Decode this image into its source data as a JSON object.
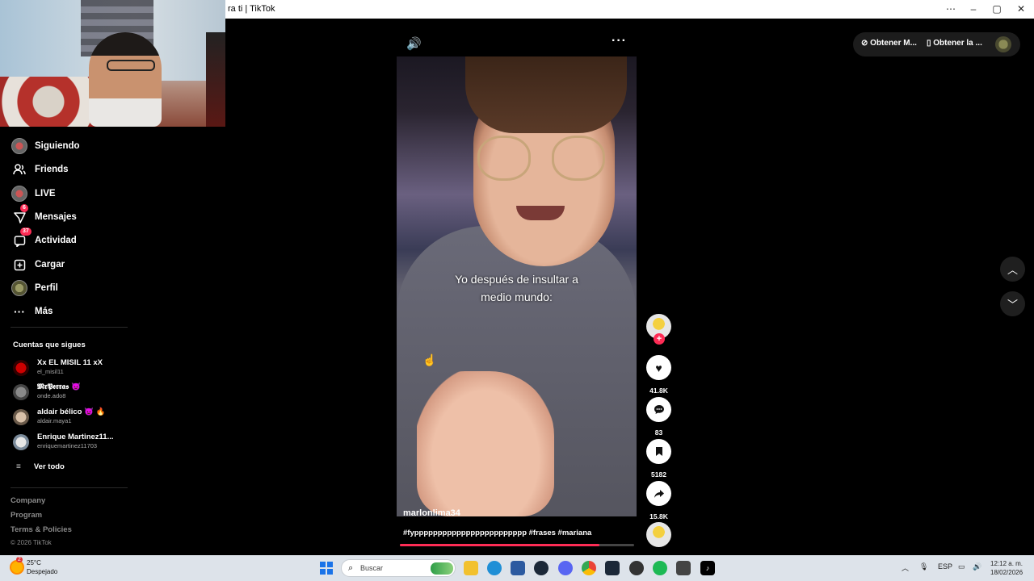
{
  "window": {
    "title": "ra ti | TikTok",
    "controls": [
      "⋯",
      "–",
      "▢",
      "✕"
    ]
  },
  "sidebar": {
    "nav": [
      {
        "label": "Siguiendo",
        "icon": "following-avatar-icon",
        "badge": ""
      },
      {
        "label": "Friends",
        "icon": "friends-icon",
        "badge": ""
      },
      {
        "label": "LIVE",
        "icon": "live-avatar-icon",
        "badge": ""
      },
      {
        "label": "Mensajes",
        "icon": "messages-icon",
        "badge": "6"
      },
      {
        "label": "Actividad",
        "icon": "activity-icon",
        "badge": "37"
      },
      {
        "label": "Cargar",
        "icon": "upload-icon",
        "badge": ""
      },
      {
        "label": "Perfil",
        "icon": "profile-avatar-icon",
        "badge": ""
      },
      {
        "label": "Más",
        "icon": "more-icon",
        "badge": ""
      }
    ],
    "following_title": "Cuentas que sigues",
    "following": [
      {
        "name": "Xx EL MISIL 11 xX",
        "handle": "el_misil11"
      },
      {
        "name": "𝕸𝖗𝕻𝖊𝖗𝖗𝖆𝖘 👿",
        "handle": "onde.ado8"
      },
      {
        "name": "aldair bélico 👿 🔥",
        "handle": "aldair.maya1"
      },
      {
        "name": "Enrique Martinez11...",
        "handle": "enriquemartinez11703"
      }
    ],
    "see_all": "Ver todo",
    "footer": [
      "Company",
      "Program",
      "Terms & Policies"
    ],
    "copyright": "© 2026 TikTok"
  },
  "video": {
    "caption_line1": "Yo después de insultar a",
    "caption_line2": "medio mundo:",
    "author": "marlonlima34",
    "description": "#fypppppppppppppppppppppppp #frases #mariana",
    "progress": 0.85,
    "volume_icon": "🔊",
    "more_icon": "···"
  },
  "actions": {
    "likes": "41.8K",
    "comments": "83",
    "saves": "5182",
    "shares": "15.8K"
  },
  "top_right": {
    "coins_label": "Obtener M...",
    "app_label": "Obtener la ..."
  },
  "taskbar": {
    "weather_temp": "25°C",
    "weather_desc": "Despejado",
    "weather_badge": "2",
    "search_placeholder": "Buscar",
    "lang": "ESP",
    "time": "12:12 a. m.",
    "date": "18/02/2026"
  },
  "colors": {
    "accent": "#fe2c55",
    "background": "#000000"
  }
}
